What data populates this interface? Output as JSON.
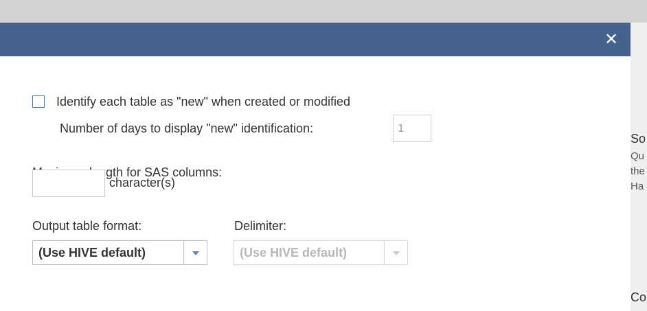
{
  "background_panel": {
    "fragments": [
      "So",
      "Qu",
      "the",
      "Ha",
      "Co"
    ]
  },
  "dialog": {
    "close_symbol": "✕",
    "new_table": {
      "checkbox_label": "Identify each table as \"new\" when created or modified",
      "checked": false,
      "days_label": "Number of days to display \"new\" identification:",
      "days_value": "1"
    },
    "sas_columns": {
      "label": "Maximum length for SAS columns:",
      "value": "",
      "unit": "character(s)"
    },
    "output_format": {
      "label": "Output table format:",
      "selected": "(Use HIVE default)"
    },
    "delimiter": {
      "label": "Delimiter:",
      "selected": "(Use HIVE default)",
      "enabled": false
    }
  },
  "colors": {
    "header": "#43628c",
    "checkbox_border": "#3f7fc0",
    "dropdown_arrow": "#5b87c0"
  },
  "icons": {
    "close": "close-icon",
    "dropdown": "chevron-down-icon"
  }
}
